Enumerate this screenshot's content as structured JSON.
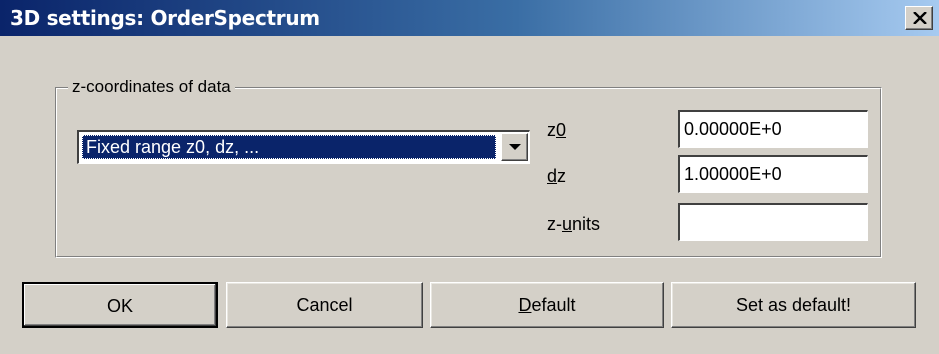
{
  "window": {
    "title": "3D settings: OrderSpectrum",
    "close_symbol": "✕"
  },
  "group": {
    "legend": "z-coordinates of data"
  },
  "mode_select": {
    "selected": "Fixed range z0, dz, ..."
  },
  "fields": {
    "z0": {
      "label_pre": "z",
      "label_mnemonic": "0",
      "label_post": "",
      "value": "0.00000E+0"
    },
    "dz": {
      "label_pre": "",
      "label_mnemonic": "d",
      "label_post": "z",
      "value": "1.00000E+0"
    },
    "zunits": {
      "label_pre": "z-",
      "label_mnemonic": "u",
      "label_post": "nits",
      "value": ""
    }
  },
  "buttons": {
    "ok": "OK",
    "cancel": "Cancel",
    "default_mnemonic": "D",
    "default_rest": "efault",
    "set_default": "Set as default!"
  },
  "icons": {
    "close": "close-icon",
    "dropdown": "chevron-down-icon"
  }
}
